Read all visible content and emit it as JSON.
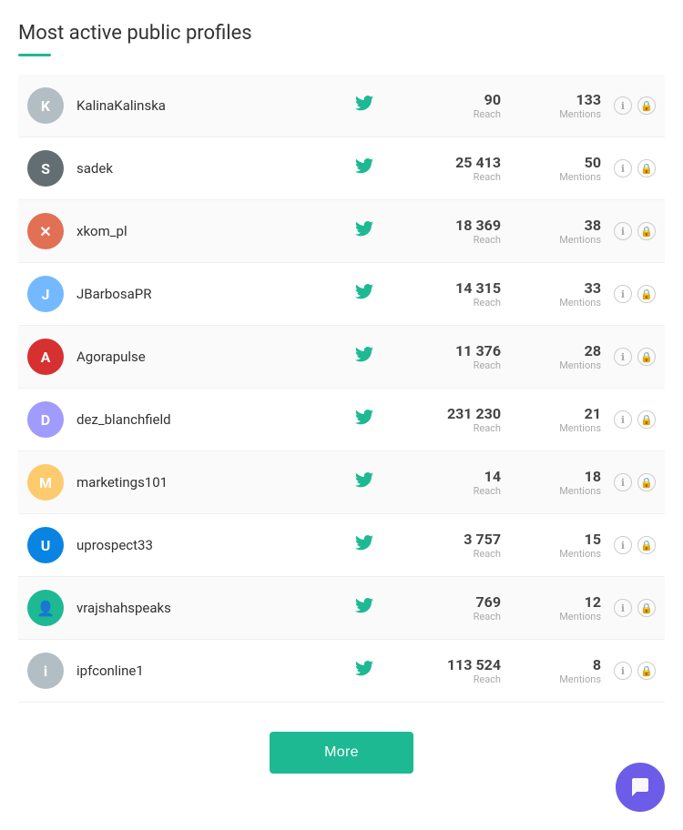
{
  "section": {
    "title": "Most active public profiles",
    "more_button": "More"
  },
  "profiles": [
    {
      "id": 1,
      "name": "KalinaKalinska",
      "avatar_text": "K",
      "avatar_color": "#b2bec3",
      "reach_value": "90",
      "reach_label": "Reach",
      "mentions_value": "133",
      "mentions_label": "Mentions"
    },
    {
      "id": 2,
      "name": "sadek",
      "avatar_text": "S",
      "avatar_color": "#636e72",
      "reach_value": "25 413",
      "reach_label": "Reach",
      "mentions_value": "50",
      "mentions_label": "Mentions"
    },
    {
      "id": 3,
      "name": "xkom_pl",
      "avatar_text": "✕",
      "avatar_color": "#e17055",
      "reach_value": "18 369",
      "reach_label": "Reach",
      "mentions_value": "38",
      "mentions_label": "Mentions"
    },
    {
      "id": 4,
      "name": "JBarbosaPR",
      "avatar_text": "J",
      "avatar_color": "#74b9ff",
      "reach_value": "14 315",
      "reach_label": "Reach",
      "mentions_value": "33",
      "mentions_label": "Mentions"
    },
    {
      "id": 5,
      "name": "Agorapulse",
      "avatar_text": "A",
      "avatar_color": "#d63031",
      "reach_value": "11 376",
      "reach_label": "Reach",
      "mentions_value": "28",
      "mentions_label": "Mentions"
    },
    {
      "id": 6,
      "name": "dez_blanchfield",
      "avatar_text": "D",
      "avatar_color": "#a29bfe",
      "reach_value": "231 230",
      "reach_label": "Reach",
      "mentions_value": "21",
      "mentions_label": "Mentions"
    },
    {
      "id": 7,
      "name": "marketings101",
      "avatar_text": "M",
      "avatar_color": "#fdcb6e",
      "reach_value": "14",
      "reach_label": "Reach",
      "mentions_value": "18",
      "mentions_label": "Mentions"
    },
    {
      "id": 8,
      "name": "uprospect33",
      "avatar_text": "U",
      "avatar_color": "#0984e3",
      "reach_value": "3 757",
      "reach_label": "Reach",
      "mentions_value": "15",
      "mentions_label": "Mentions"
    },
    {
      "id": 9,
      "name": "vrajshahspeaks",
      "avatar_text": "👤",
      "avatar_color": "#1db992",
      "reach_value": "769",
      "reach_label": "Reach",
      "mentions_value": "12",
      "mentions_label": "Mentions"
    },
    {
      "id": 10,
      "name": "ipfconline1",
      "avatar_text": "i",
      "avatar_color": "#b2bec3",
      "reach_value": "113 524",
      "reach_label": "Reach",
      "mentions_value": "8",
      "mentions_label": "Mentions"
    }
  ]
}
